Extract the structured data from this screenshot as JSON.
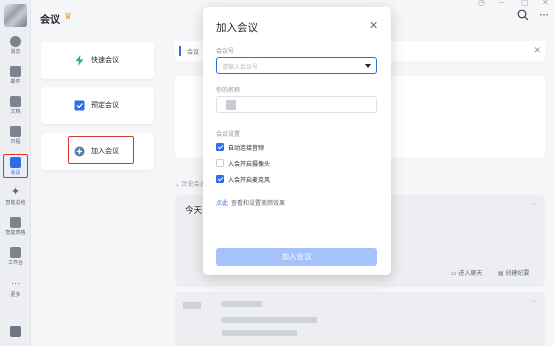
{
  "sidebar": {
    "items": [
      {
        "label": "消息"
      },
      {
        "label": "邮件"
      },
      {
        "label": "文档"
      },
      {
        "label": "日程"
      },
      {
        "label": "会议"
      },
      {
        "label": "智能总结"
      },
      {
        "label": "智能表格"
      },
      {
        "label": "工作台"
      },
      {
        "label": "更多"
      }
    ]
  },
  "header": {
    "title": "会议",
    "crown": "♛"
  },
  "cards": [
    {
      "label": "快速会议"
    },
    {
      "label": "预定会议"
    },
    {
      "label": "加入会议"
    }
  ],
  "banner": {
    "text": "会议"
  },
  "history": {
    "label": "历史会议",
    "day": "今天",
    "enter_chat": "进入聊天",
    "create_record": "创建纪要"
  },
  "dialog": {
    "title": "加入会议",
    "meeting_id_label": "会议号",
    "meeting_id_placeholder": "请输入会议号",
    "name_label": "你的名称",
    "settings_label": "会议设置",
    "options": [
      {
        "label": "自动连接音频",
        "checked": true
      },
      {
        "label": "入会开启摄像头",
        "checked": false
      },
      {
        "label": "入会开启麦克风",
        "checked": true
      }
    ],
    "link_text": "点此",
    "link_hint": "查看和设置美颜效果",
    "join_button": "加入会议"
  },
  "colors": {
    "accent": "#2f6bea",
    "highlight": "#d23a30"
  }
}
